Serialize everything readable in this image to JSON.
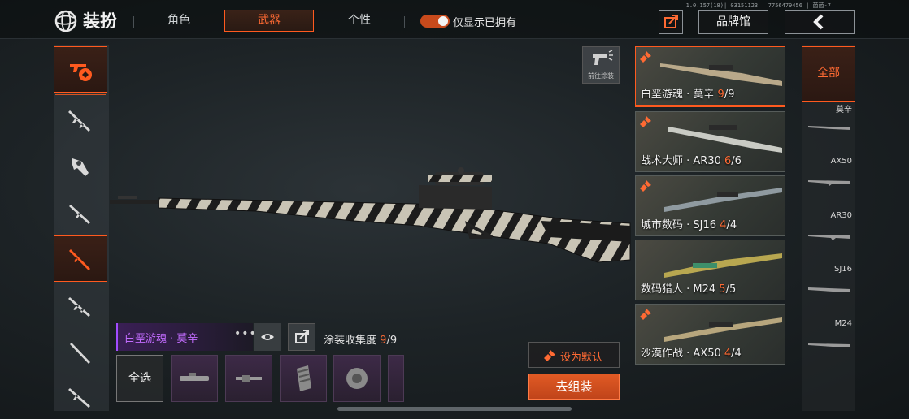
{
  "version_text": "1.0.157(18)| 03151123 | 7756479456 | 菌菌-7",
  "title": "装扮",
  "tabs": [
    {
      "label": "角色",
      "active": false
    },
    {
      "label": "武器",
      "active": true
    },
    {
      "label": "个性",
      "active": false
    }
  ],
  "toggle": {
    "label": "仅显示已拥有",
    "on": true
  },
  "toolbar": {
    "brand_label": "品牌馆"
  },
  "sidebar": {
    "items": [
      {
        "icon": "weapon-skin-icon",
        "active": true
      },
      {
        "icon": "assault-rifle-icon",
        "active": false
      },
      {
        "icon": "smg-icon",
        "active": false
      },
      {
        "icon": "rifle-icon",
        "active": false
      },
      {
        "icon": "sniper-rifle-icon",
        "active": true
      },
      {
        "icon": "carbine-icon",
        "active": false
      },
      {
        "icon": "shotgun-icon",
        "active": false
      },
      {
        "icon": "dmr-icon",
        "active": false
      }
    ]
  },
  "preview": {
    "coat_label": "前往涂装"
  },
  "skin_bar": {
    "name": "白垩游魂 · 莫辛",
    "collect_label": "涂装收集度",
    "collect_value": "9",
    "collect_total": "/9",
    "select_all": "全选"
  },
  "actions": {
    "set_default": "设为默认",
    "assemble": "去组装"
  },
  "skins": [
    {
      "name": "白垩游魂 · 莫辛",
      "owned": "9",
      "total": "/9",
      "active": true
    },
    {
      "name": "战术大师 · AR30",
      "owned": "6",
      "total": "/6",
      "active": false
    },
    {
      "name": "城市数码 · SJ16",
      "owned": "4",
      "total": "/4",
      "active": false
    },
    {
      "name": "数码猎人 · M24",
      "owned": "5",
      "total": "/5",
      "active": false
    },
    {
      "name": "沙漠作战 · AX50",
      "owned": "4",
      "total": "/4",
      "active": false
    }
  ],
  "filters": {
    "all": "全部",
    "items": [
      "莫辛",
      "AX50",
      "AR30",
      "SJ16",
      "M24"
    ]
  },
  "colors": {
    "accent": "#ff5a1f",
    "rare_purple": "#a14cff"
  }
}
